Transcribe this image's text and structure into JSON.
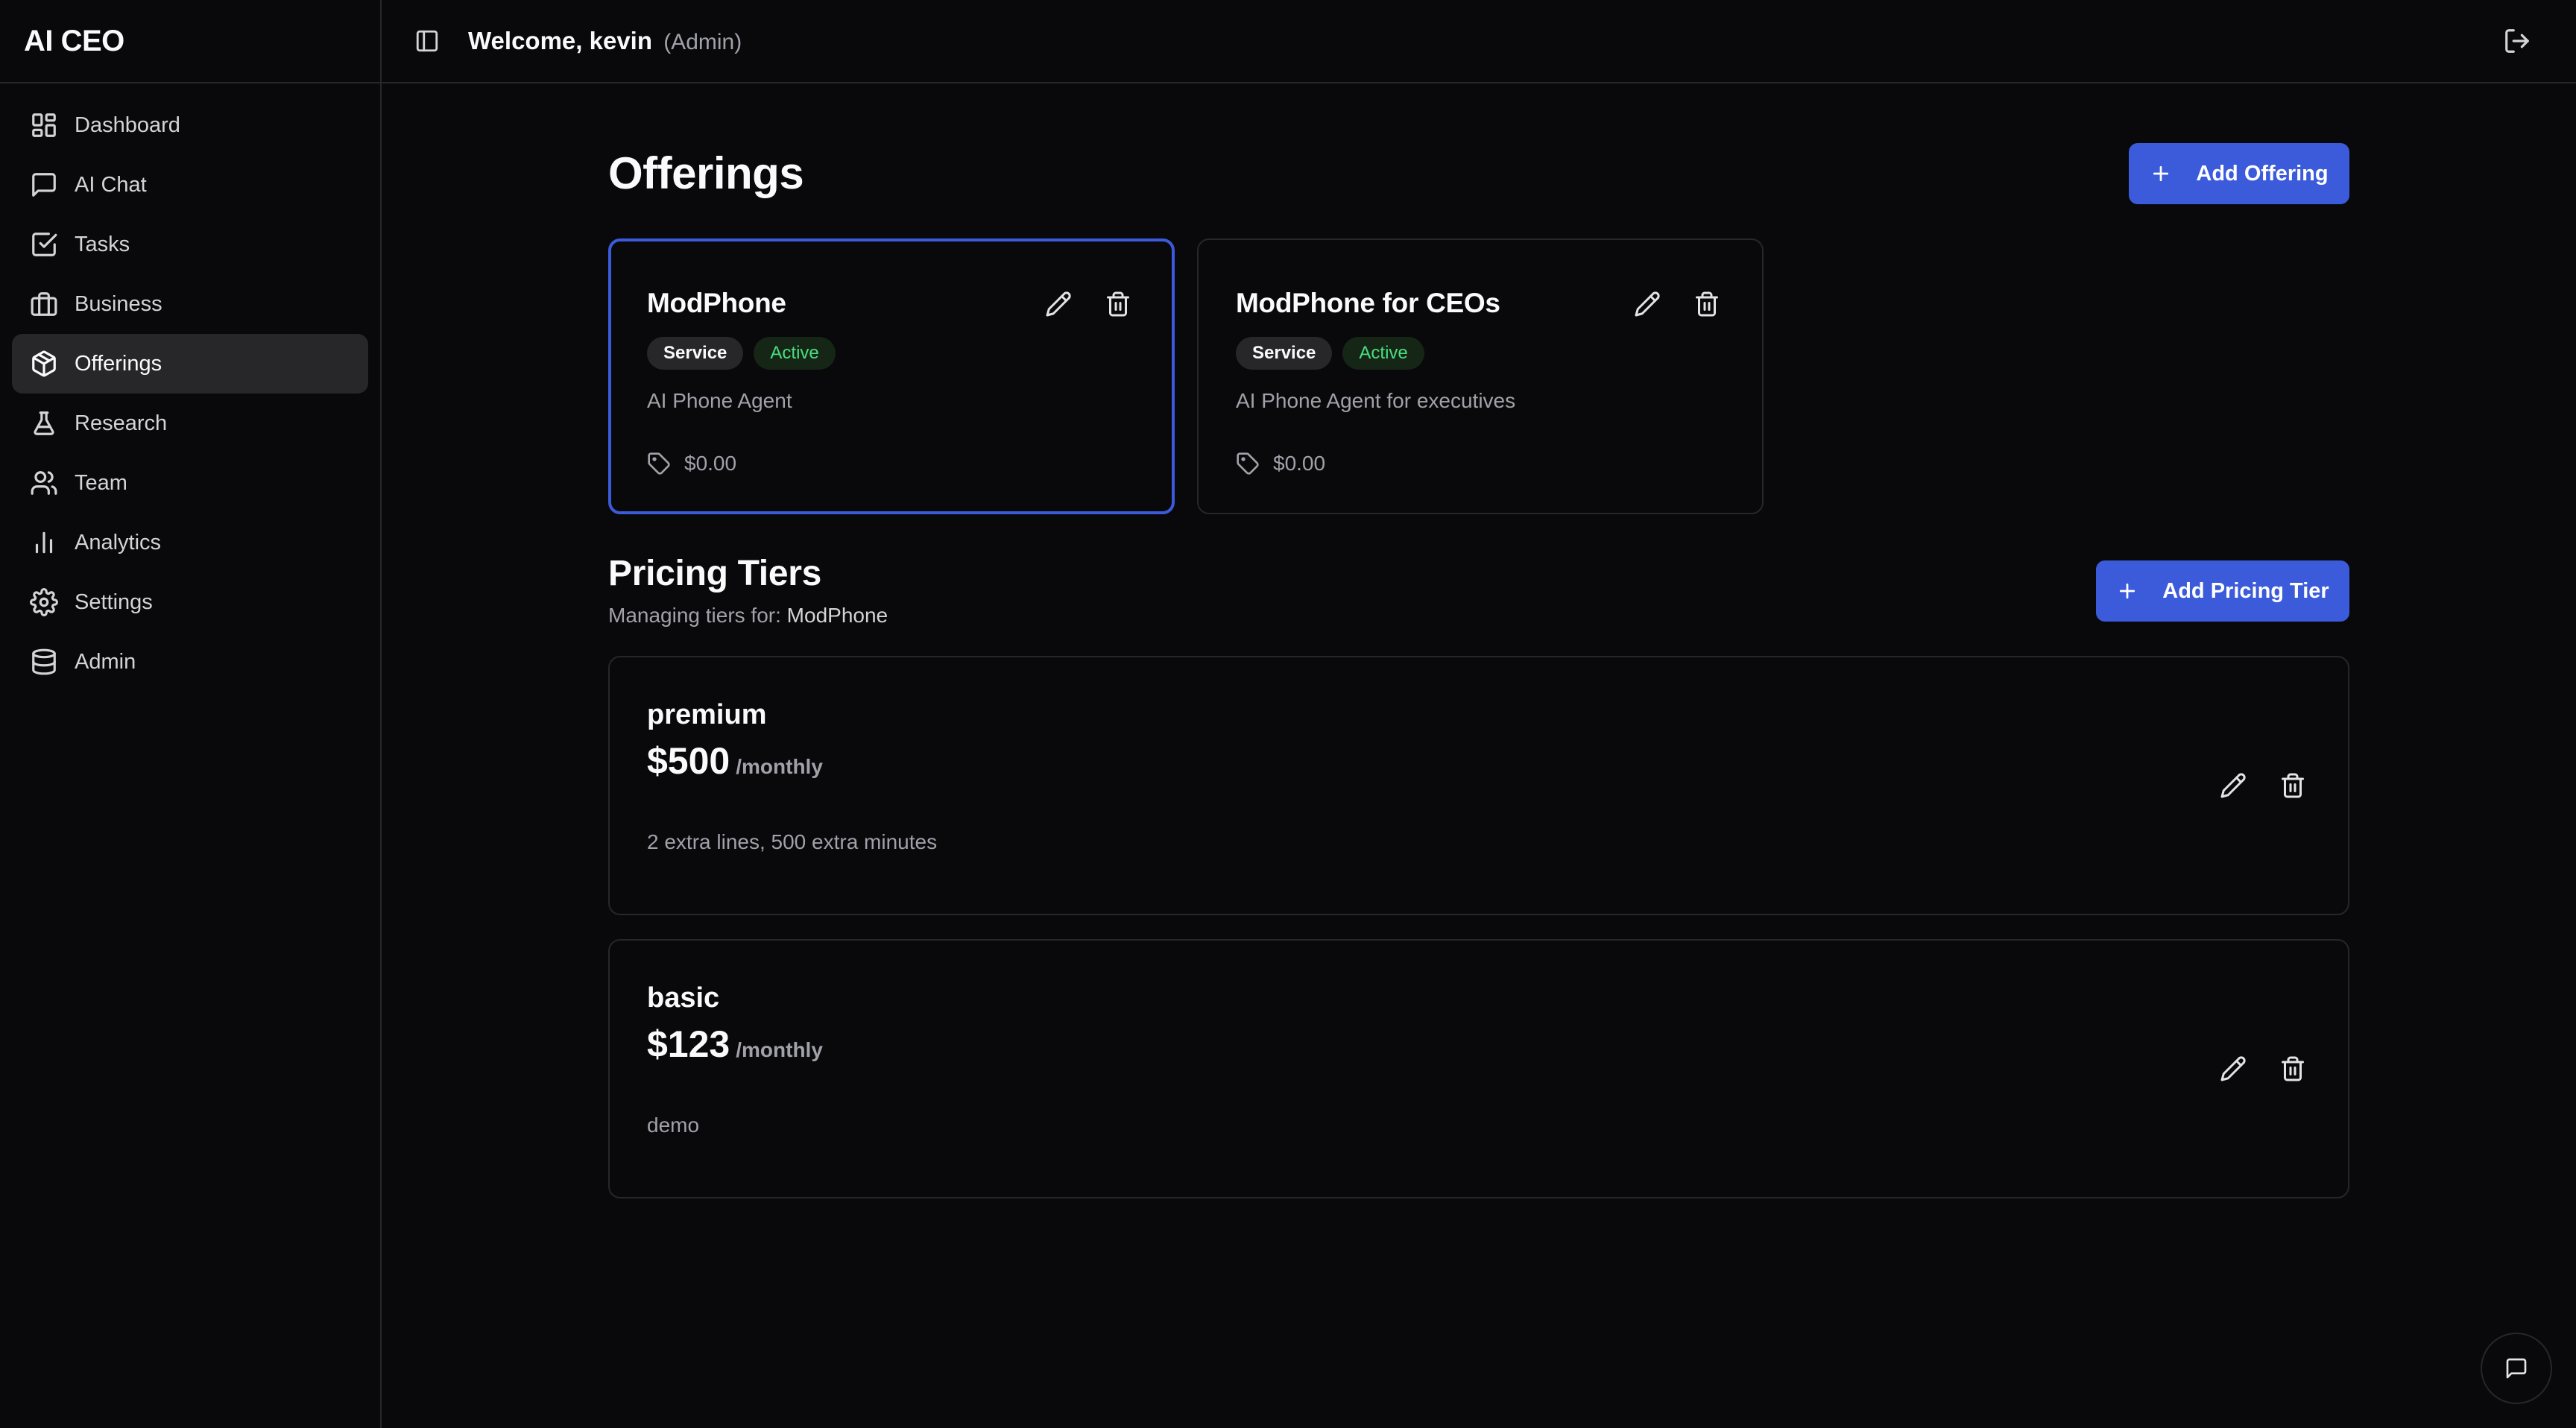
{
  "app": {
    "title": "AI CEO"
  },
  "sidebar": {
    "items": [
      {
        "label": "Dashboard",
        "icon": "layout-dashboard-icon"
      },
      {
        "label": "AI Chat",
        "icon": "message-square-icon"
      },
      {
        "label": "Tasks",
        "icon": "check-square-icon"
      },
      {
        "label": "Business",
        "icon": "briefcase-icon"
      },
      {
        "label": "Offerings",
        "icon": "package-icon",
        "active": true
      },
      {
        "label": "Research",
        "icon": "flask-icon"
      },
      {
        "label": "Team",
        "icon": "users-icon"
      },
      {
        "label": "Analytics",
        "icon": "bar-chart-icon"
      },
      {
        "label": "Settings",
        "icon": "gear-icon"
      },
      {
        "label": "Admin",
        "icon": "database-icon"
      }
    ]
  },
  "header": {
    "welcome": "Welcome, kevin",
    "role": "(Admin)"
  },
  "offerings": {
    "title": "Offerings",
    "add_label": "Add Offering",
    "cards": [
      {
        "name": "ModPhone",
        "type": "Service",
        "status": "Active",
        "description": "AI Phone Agent",
        "price": "$0.00",
        "selected": true
      },
      {
        "name": "ModPhone for CEOs",
        "type": "Service",
        "status": "Active",
        "description": "AI Phone Agent for executives",
        "price": "$0.00",
        "selected": false
      }
    ]
  },
  "pricing": {
    "title": "Pricing Tiers",
    "subtitle_prefix": "Managing tiers for:",
    "subtitle_offering": "ModPhone",
    "add_label": "Add Pricing Tier",
    "tiers": [
      {
        "name": "premium",
        "price": "$500",
        "period": "/monthly",
        "description": "2 extra lines, 500 extra minutes"
      },
      {
        "name": "basic",
        "price": "$123",
        "period": "/monthly",
        "description": "demo"
      }
    ]
  },
  "colors": {
    "accent": "#3b5bdb",
    "background": "#09090b",
    "border": "#27272a",
    "success": "#4ade80"
  }
}
